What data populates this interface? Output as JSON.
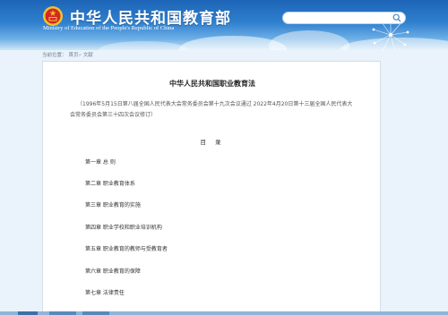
{
  "header": {
    "title_cn": "中华人民共和国教育部",
    "title_en": "Ministry of Education of the People's Republic of China",
    "search_placeholder": ""
  },
  "breadcrumb": {
    "prefix": "当前位置：",
    "items": [
      "首页",
      "文献"
    ]
  },
  "document": {
    "title": "中华人民共和国职业教育法",
    "note": "（1996年5月15日第八届全国人民代表大会常务委员会第十九次会议通过 2022年4月20日第十三届全国人民代表大会常务委员会第三十四次会议修订）",
    "toc_heading": "目 录",
    "toc": [
      "第一章 总 则",
      "第二章 职业教育体系",
      "第三章 职业教育的实施",
      "第四章 职业学校和职业培训机构",
      "第五章 职业教育的教师与受教育者",
      "第六章 职业教育的保障",
      "第七章 法律责任"
    ]
  },
  "colors": {
    "header_blue": "#1d64b7",
    "page_bg": "#eaf3fb",
    "emblem_red": "#d42a20",
    "emblem_gold": "#f1c232"
  }
}
